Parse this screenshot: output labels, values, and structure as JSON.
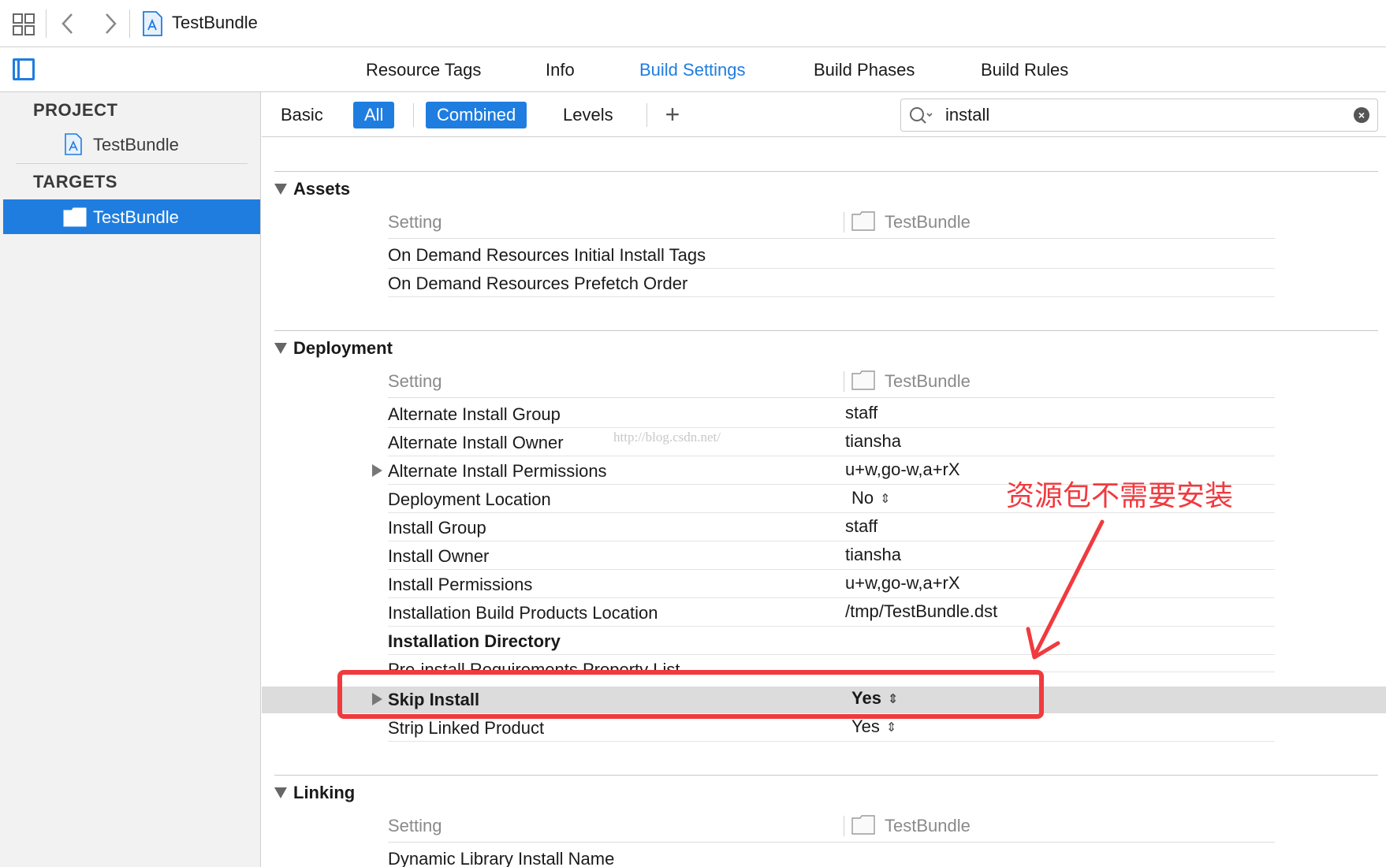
{
  "toolbar": {
    "breadcrumb_title": "TestBundle"
  },
  "tabs": [
    {
      "label": "Resource Tags"
    },
    {
      "label": "Info"
    },
    {
      "label": "Build Settings"
    },
    {
      "label": "Build Phases"
    },
    {
      "label": "Build Rules"
    }
  ],
  "sidebar": {
    "project_header": "PROJECT",
    "project_item": "TestBundle",
    "targets_header": "TARGETS",
    "target_item": "TestBundle"
  },
  "filter": {
    "basic": "Basic",
    "all": "All",
    "combined": "Combined",
    "levels": "Levels"
  },
  "search": {
    "value": "install"
  },
  "accent_color": "#1f7de0",
  "annotation_color": "#f03a3e",
  "sections": {
    "assets": {
      "title": "Assets",
      "col_setting": "Setting",
      "col_target": "TestBundle",
      "rows": [
        {
          "name": "On Demand Resources Initial Install Tags",
          "value": ""
        },
        {
          "name": "On Demand Resources Prefetch Order",
          "value": ""
        }
      ]
    },
    "deployment": {
      "title": "Deployment",
      "col_setting": "Setting",
      "col_target": "TestBundle",
      "rows": [
        {
          "name": "Alternate Install Group",
          "value": "staff"
        },
        {
          "name": "Alternate Install Owner",
          "value": "tiansha"
        },
        {
          "name": "Alternate Install Permissions",
          "value": "u+w,go-w,a+rX"
        },
        {
          "name": "Deployment Location",
          "value": "No"
        },
        {
          "name": "Install Group",
          "value": "staff"
        },
        {
          "name": "Install Owner",
          "value": "tiansha"
        },
        {
          "name": "Install Permissions",
          "value": "u+w,go-w,a+rX"
        },
        {
          "name": "Installation Build Products Location",
          "value": "/tmp/TestBundle.dst"
        },
        {
          "name": "Installation Directory",
          "value": ""
        },
        {
          "name": "Pre-install Requirements Property List",
          "value": ""
        },
        {
          "name": "Skip Install",
          "value": "Yes"
        },
        {
          "name": "Strip Linked Product",
          "value": "Yes"
        }
      ]
    },
    "linking": {
      "title": "Linking",
      "col_setting": "Setting",
      "col_target": "TestBundle",
      "rows": [
        {
          "name": "Dynamic Library Install Name",
          "value": ""
        }
      ]
    }
  },
  "watermark": "http://blog.csdn.net/",
  "annotation": {
    "text": "资源包不需要安装"
  }
}
